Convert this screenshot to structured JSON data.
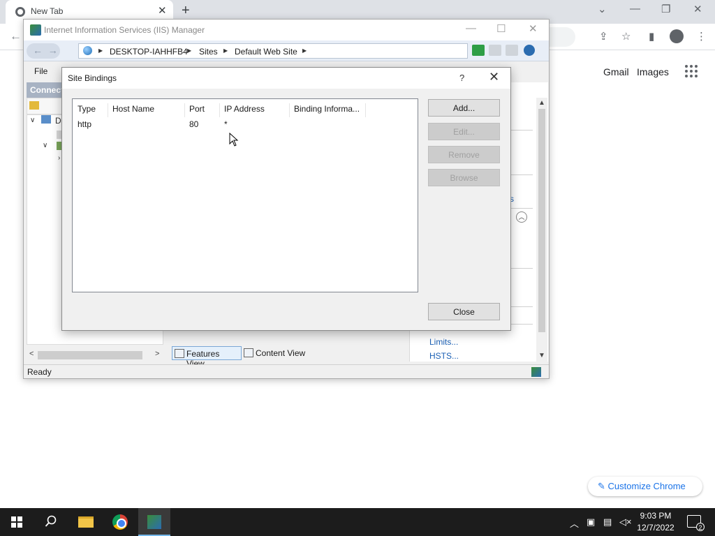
{
  "chrome": {
    "tab_title": "New Tab",
    "links": {
      "gmail": "Gmail",
      "images": "Images"
    },
    "customize_label": "Customize Chrome"
  },
  "iis": {
    "title": "Internet Information Services (IIS) Manager",
    "breadcrumb": [
      "DESKTOP-IAHHFB4",
      "Sites",
      "Default Web Site"
    ],
    "menu_file": "File",
    "connections_label": "Connect",
    "tree_server_label": "D",
    "views": {
      "features": "Features View",
      "content": "Content View"
    },
    "actions_links": [
      "Limits...",
      "HSTS..."
    ],
    "actions_partial_link": "s",
    "status": "Ready"
  },
  "dialog": {
    "title": "Site Bindings",
    "help": "?",
    "columns": [
      "Type",
      "Host Name",
      "Port",
      "IP Address",
      "Binding Informa..."
    ],
    "rows": [
      {
        "type": "http",
        "host": "",
        "port": "80",
        "ip": "*",
        "info": ""
      }
    ],
    "buttons": {
      "add": "Add...",
      "edit": "Edit...",
      "remove": "Remove",
      "browse": "Browse",
      "close": "Close"
    }
  },
  "taskbar": {
    "time": "9:03 PM",
    "date": "12/7/2022",
    "notification_count": "2"
  },
  "colors": {
    "accent_link": "#1a5fb4",
    "chrome_blue": "#1a73e8",
    "taskbar_bg": "#1c1c1c"
  }
}
